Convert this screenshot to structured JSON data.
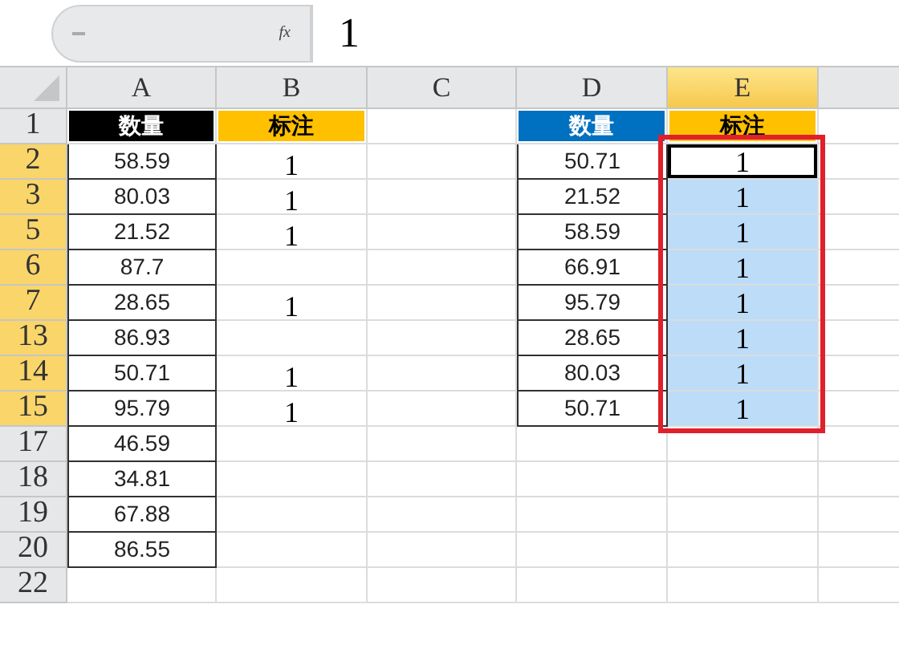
{
  "formula_bar": {
    "function_label": "fx",
    "value": "1"
  },
  "columns": [
    {
      "label": "A",
      "selected": false
    },
    {
      "label": "B",
      "selected": false
    },
    {
      "label": "C",
      "selected": false
    },
    {
      "label": "D",
      "selected": false
    },
    {
      "label": "E",
      "selected": true
    }
  ],
  "rows": [
    {
      "label": "1",
      "selected": false,
      "a": {
        "text": "数量",
        "color": "#000000"
      },
      "b": {
        "text": "标注",
        "color": "#ffc000"
      },
      "d": {
        "text": "数量",
        "color": "#0070c0"
      },
      "e": {
        "text": "标注",
        "color": "#ffc000"
      }
    },
    {
      "label": "2",
      "selected": true,
      "a": "58.59",
      "b": "1",
      "d": "50.71",
      "e": {
        "text": "1",
        "selected": true,
        "active": true
      }
    },
    {
      "label": "3",
      "selected": true,
      "a": "80.03",
      "b": "1",
      "d": "21.52",
      "e": {
        "text": "1",
        "selected": true,
        "active": false
      }
    },
    {
      "label": "5",
      "selected": true,
      "a": "21.52",
      "b": "1",
      "d": "58.59",
      "e": {
        "text": "1",
        "selected": true,
        "active": false
      }
    },
    {
      "label": "6",
      "selected": true,
      "a": "87.7",
      "d": "66.91",
      "e": {
        "text": "1",
        "selected": true,
        "active": false
      }
    },
    {
      "label": "7",
      "selected": true,
      "a": "28.65",
      "b": "1",
      "d": "95.79",
      "e": {
        "text": "1",
        "selected": true,
        "active": false
      }
    },
    {
      "label": "13",
      "selected": true,
      "a": "86.93",
      "d": "28.65",
      "e": {
        "text": "1",
        "selected": true,
        "active": false
      }
    },
    {
      "label": "14",
      "selected": true,
      "a": "50.71",
      "b": "1",
      "d": "80.03",
      "e": {
        "text": "1",
        "selected": true,
        "active": false
      }
    },
    {
      "label": "15",
      "selected": true,
      "a": "95.79",
      "b": "1",
      "d": "50.71",
      "e": {
        "text": "1",
        "selected": true,
        "active": false
      }
    },
    {
      "label": "17",
      "selected": false,
      "a": "46.59"
    },
    {
      "label": "18",
      "selected": false,
      "a": "34.81"
    },
    {
      "label": "19",
      "selected": false,
      "a": "67.88"
    },
    {
      "label": "20",
      "selected": false,
      "a": "86.55"
    },
    {
      "label": "22",
      "selected": false
    }
  ]
}
